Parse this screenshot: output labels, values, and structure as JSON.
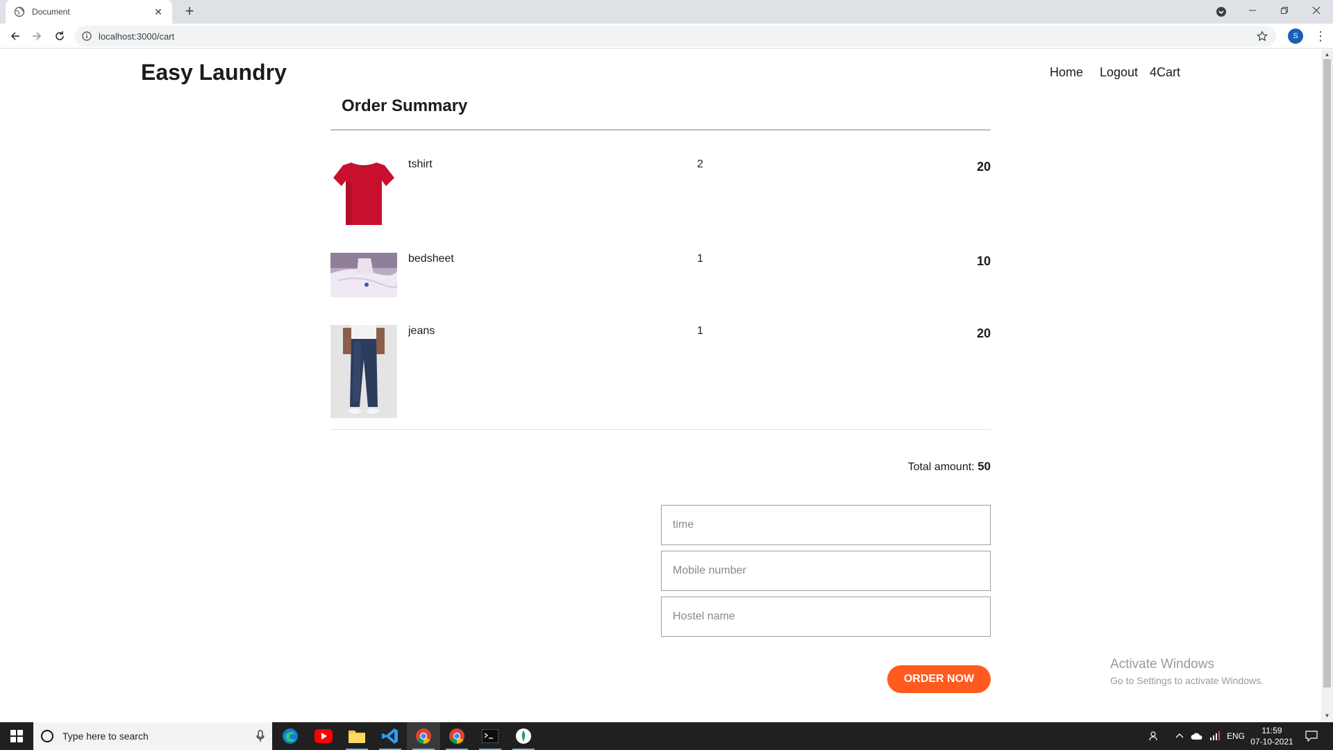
{
  "browser": {
    "tab_title": "Document",
    "tab_close": "✕",
    "new_tab": "+",
    "url": "localhost:3000/cart",
    "profile_initial": "S",
    "menu": "⋮"
  },
  "header": {
    "brand": "Easy Laundry",
    "nav": [
      "Home",
      "Logout",
      "4Cart"
    ]
  },
  "summary": {
    "title": "Order Summary",
    "items": [
      {
        "name": "tshirt",
        "qty": "2",
        "price": "20",
        "image": "red-tshirt"
      },
      {
        "name": "bedsheet",
        "qty": "1",
        "price": "10",
        "image": "white-bedsheet"
      },
      {
        "name": "jeans",
        "qty": "1",
        "price": "20",
        "image": "blue-jeans"
      }
    ],
    "total_label": "Total amount:",
    "total_value": "50"
  },
  "form": {
    "time_placeholder": "time",
    "mobile_placeholder": "Mobile number",
    "hostel_placeholder": "Hostel name",
    "order_button": "ORDER NOW"
  },
  "watermark": {
    "line1": "Activate Windows",
    "line2": "Go to Settings to activate Windows."
  },
  "taskbar": {
    "search_placeholder": "Type here to search",
    "language": "ENG",
    "time": "11:59",
    "date": "07-10-2021"
  },
  "colors": {
    "accent": "#ff5a1f",
    "taskbar": "#202020"
  }
}
